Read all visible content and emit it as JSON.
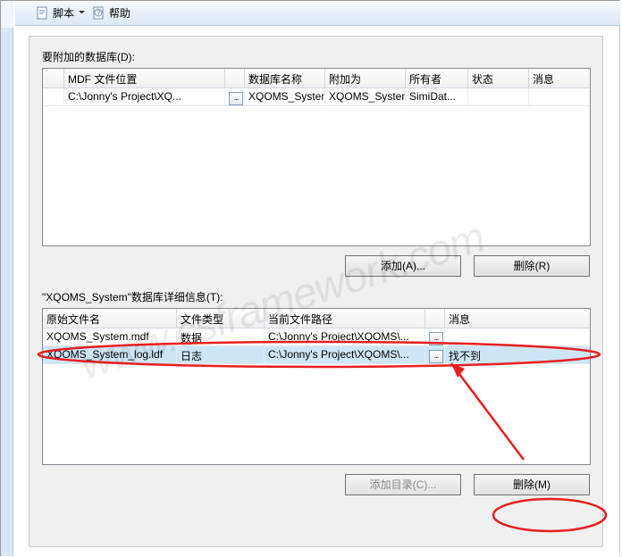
{
  "toolbar": {
    "script": "脚本",
    "help": "帮助"
  },
  "section1": {
    "label": "要附加的数据库(D):",
    "headers": {
      "blank": "",
      "mdf_location": "MDF 文件位置",
      "db_name": "数据库名称",
      "attach_as": "附加为",
      "owner": "所有者",
      "status": "状态",
      "message": "消息"
    },
    "rows": [
      {
        "mdf_location": "C:\\Jonny's Project\\XQ...",
        "db_name": "XQOMS_System",
        "attach_as": "XQOMS_System",
        "owner": "SimiDat...",
        "status": "",
        "message": ""
      }
    ]
  },
  "buttons1": {
    "add": "添加(A)...",
    "remove": "删除(R)"
  },
  "section2": {
    "label": "\"XQOMS_System\"数据库详细信息(T):",
    "headers": {
      "orig_name": "原始文件名",
      "file_type": "文件类型",
      "cur_path": "当前文件路径",
      "message": "消息"
    },
    "rows": [
      {
        "orig_name": "XQOMS_System.mdf",
        "file_type": "数据",
        "cur_path": "C:\\Jonny's Project\\XQOMS\\...",
        "message": ""
      },
      {
        "orig_name": "XQOMS_System_log.ldf",
        "file_type": "日志",
        "cur_path": "C:\\Jonny's Project\\XQOMS\\...",
        "message": "找不到"
      }
    ]
  },
  "buttons2": {
    "add_catalog": "添加目录(C)...",
    "remove_m": "删除(M)"
  },
  "watermark": "www.csframework.com"
}
